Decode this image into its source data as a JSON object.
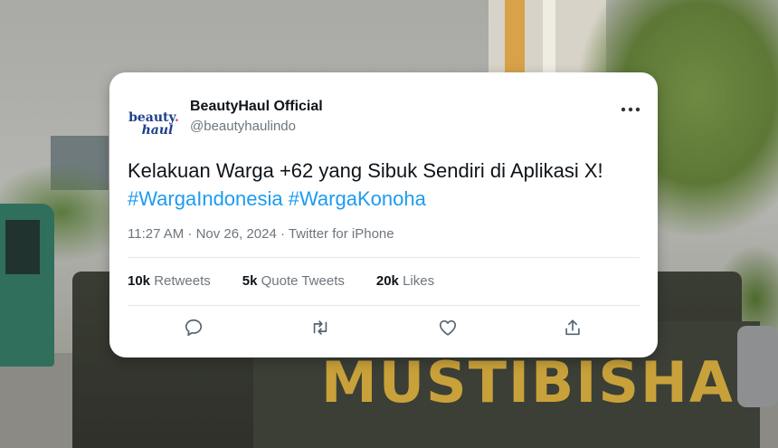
{
  "background": {
    "truck_text": "MUSTIBISHA"
  },
  "tweet": {
    "avatar": {
      "line1": "beauty",
      "dot": ".",
      "line2": "haul"
    },
    "display_name": "BeautyHaul Official",
    "handle": "@beautyhaulindo",
    "more_icon": "ellipsis-icon",
    "text": "Kelakuan Warga +62 yang Sibuk Sendiri di Aplikasi X!",
    "hashtags": "#WargaIndonesia #WargaKonoha",
    "timestamp": "11:27 AM · Nov 26, 2024 · Twitter for iPhone",
    "stats": [
      {
        "count": "10k",
        "label": "Retweets"
      },
      {
        "count": "5k",
        "label": "Quote Tweets"
      },
      {
        "count": "20k",
        "label": "Likes"
      }
    ],
    "actions": [
      "reply-icon",
      "retweet-icon",
      "like-icon",
      "share-icon"
    ],
    "colors": {
      "link": "#1d9bf0",
      "text": "#0f1419",
      "muted": "#6e767d",
      "brand": "#1f3f8c"
    }
  }
}
